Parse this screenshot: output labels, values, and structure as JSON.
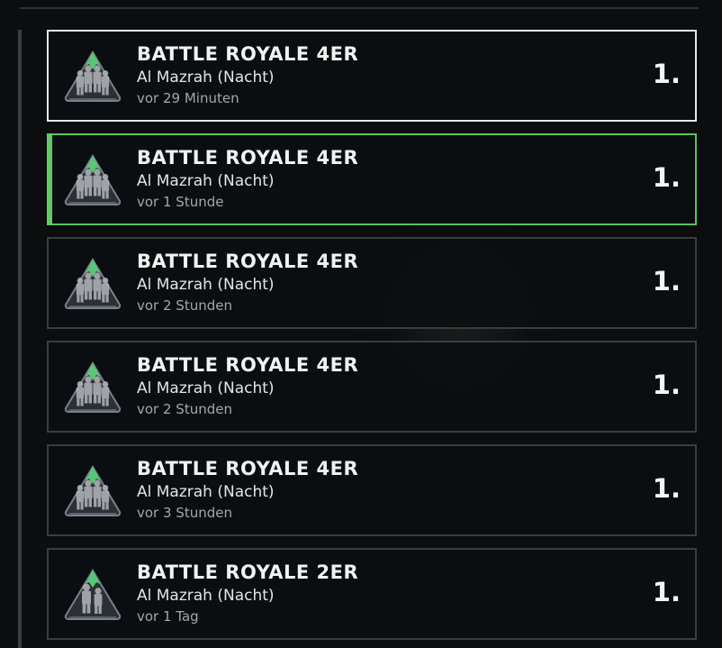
{
  "matches": [
    {
      "mode": "BATTLE ROYALE 4ER",
      "map": "Al Mazrah (Nacht)",
      "time": "vor 29 Minuten",
      "placement": "1.",
      "state": "selected",
      "icon": "squad-4-icon"
    },
    {
      "mode": "BATTLE ROYALE 4ER",
      "map": "Al Mazrah (Nacht)",
      "time": "vor 1 Stunde",
      "placement": "1.",
      "state": "hovered",
      "icon": "squad-4-icon"
    },
    {
      "mode": "BATTLE ROYALE 4ER",
      "map": "Al Mazrah (Nacht)",
      "time": "vor 2 Stunden",
      "placement": "1.",
      "state": "normal",
      "icon": "squad-4-icon"
    },
    {
      "mode": "BATTLE ROYALE 4ER",
      "map": "Al Mazrah (Nacht)",
      "time": "vor 2 Stunden",
      "placement": "1.",
      "state": "normal",
      "icon": "squad-4-icon"
    },
    {
      "mode": "BATTLE ROYALE 4ER",
      "map": "Al Mazrah (Nacht)",
      "time": "vor 3 Stunden",
      "placement": "1.",
      "state": "normal",
      "icon": "squad-4-icon"
    },
    {
      "mode": "BATTLE ROYALE 2ER",
      "map": "Al Mazrah (Nacht)",
      "time": "vor 1 Tag",
      "placement": "1.",
      "state": "normal",
      "icon": "squad-2-icon"
    }
  ],
  "colors": {
    "accent_green": "#66c766",
    "selected_border": "#e6e6e6",
    "card_border": "#3a3d40",
    "icon_mountain": "#7a8088",
    "icon_peak": "#58c878"
  }
}
